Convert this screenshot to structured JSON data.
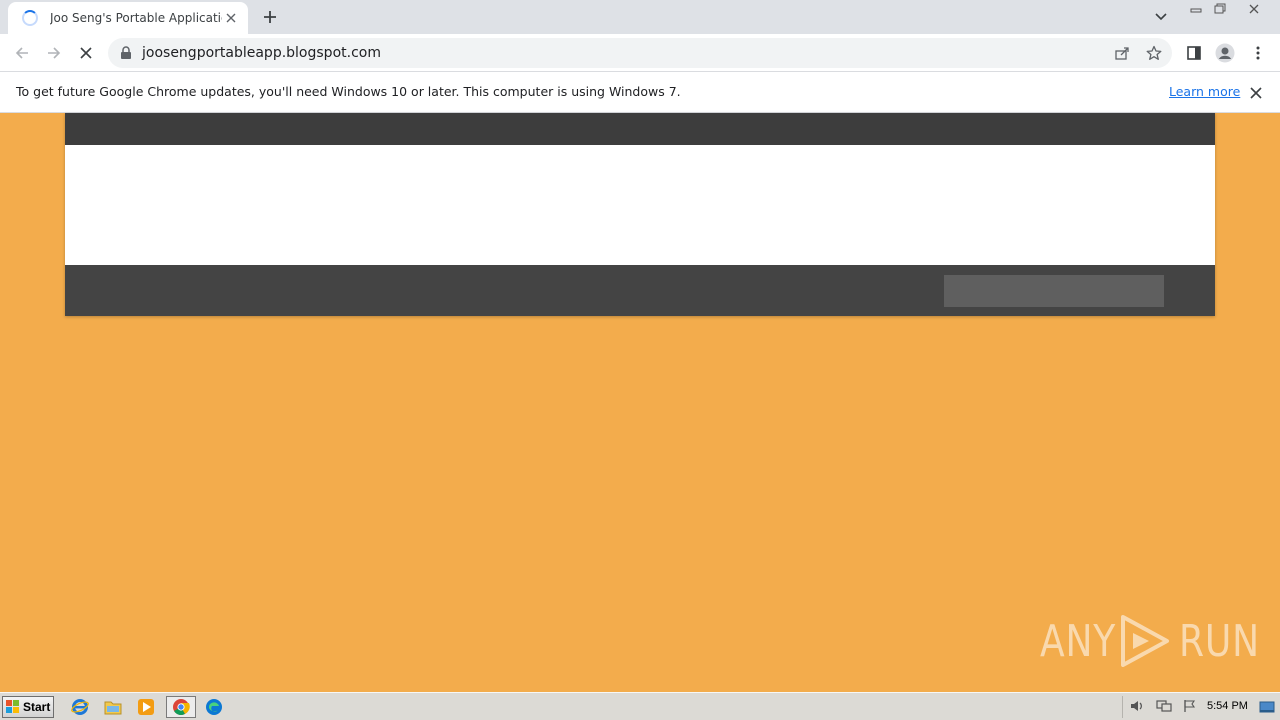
{
  "browser": {
    "tab": {
      "title": "Joo Seng's Portable Applications",
      "loading": true
    },
    "address": {
      "url": "joosengportableapp.blogspot.com"
    }
  },
  "infobar": {
    "message": "To get future Google Chrome updates, you'll need Windows 10 or later. This computer is using Windows 7.",
    "link": "Learn more"
  },
  "page": {
    "background": "#f3ac4c",
    "topbar_color": "#3d3d3d",
    "header_color": "#ffffff",
    "navbar_color": "#444444",
    "search_color": "#5f5f5f"
  },
  "watermark": {
    "text_left": "ANY",
    "text_right": "RUN"
  },
  "taskbar": {
    "start_label": "Start",
    "pinned": [
      "internet-explorer-icon",
      "file-explorer-icon",
      "media-player-icon",
      "chrome-icon",
      "edge-icon"
    ],
    "active": "chrome-icon",
    "clock": "5:54 PM"
  }
}
